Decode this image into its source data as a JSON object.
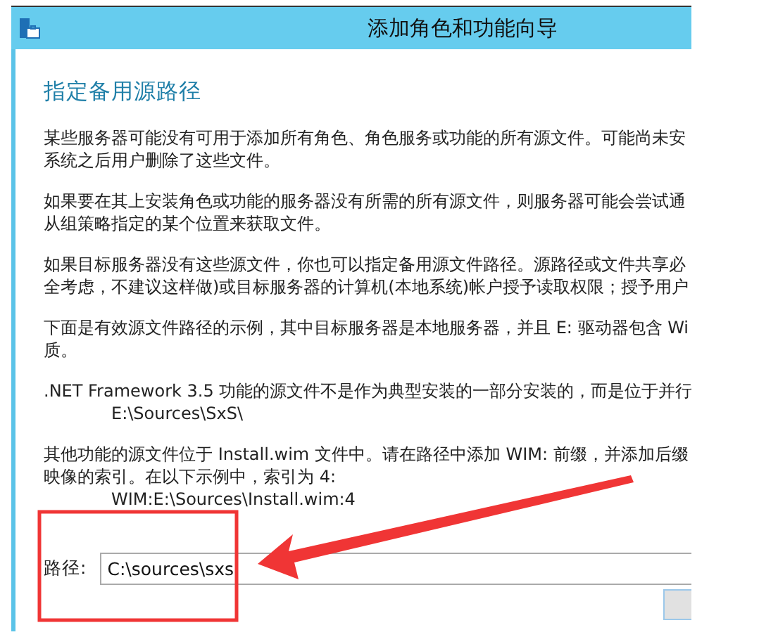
{
  "window": {
    "title": "添加角色和功能向导"
  },
  "page_heading": "指定备用源路径",
  "paragraphs": [
    {
      "lines": [
        "某些服务器可能没有可用于添加所有角色、角色服务或功能的所有源文件。可能尚未安",
        "系统之后用户删除了这些文件。"
      ]
    },
    {
      "lines": [
        "如果要在其上安装角色或功能的服务器没有所需的所有源文件，则服务器可能会尝试通",
        "从组策略指定的某个位置来获取文件。"
      ]
    },
    {
      "lines": [
        "如果目标服务器没有这些源文件，你也可以指定备用源文件路径。源路径或文件共享必",
        "全考虑，不建议这样做)或目标服务器的计算机(本地系统)帐户授予读取权限；授予用户"
      ]
    },
    {
      "lines": [
        "下面是有效源文件路径的示例，其中目标服务器是本地服务器，并且 E: 驱动器包含 Wi",
        "质。"
      ]
    },
    {
      "lines": [
        ".NET Framework 3.5 功能的源文件不是作为典型安装的一部分安装的，而是位于并行"
      ],
      "example": "E:\\Sources\\SxS\\"
    },
    {
      "lines": [
        "其他功能的源文件位于 Install.wim 文件中。请在路径中添加 WIM: 前缀，并添加后缀",
        "映像的索引。在以下示例中，索引为 4:"
      ],
      "example": "WIM:E:\\Sources\\Install.wim:4"
    }
  ],
  "path_field": {
    "label": "路径:",
    "value": "C:\\sources\\sxs"
  }
}
